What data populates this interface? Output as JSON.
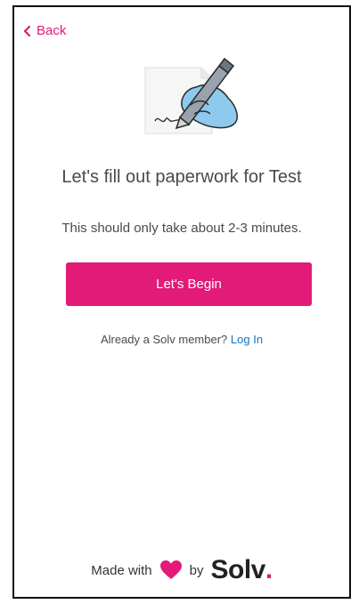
{
  "nav": {
    "back_label": "Back"
  },
  "main": {
    "title": "Let's fill out paperwork for Test",
    "subtitle": "This should only take about 2-3 minutes.",
    "begin_label": "Let's Begin",
    "member_prompt": "Already a Solv member?",
    "login_label": "Log In"
  },
  "footer": {
    "made_with": "Made with",
    "by": "by",
    "brand": "Solv",
    "brand_dot": "."
  },
  "colors": {
    "accent": "#e21a78",
    "link": "#1a73c9",
    "text": "#4a4a4a"
  },
  "icons": [
    "chevron-left-icon",
    "paperwork-illustration",
    "heart-icon"
  ]
}
